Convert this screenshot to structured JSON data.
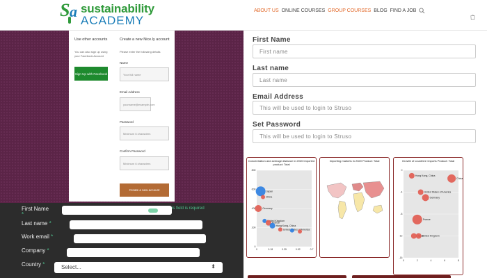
{
  "header": {
    "logo_line1": "sustainability",
    "logo_line2": "ACADEMY",
    "nav": [
      {
        "label": "ABOUT US",
        "active": true
      },
      {
        "label": "ONLINE COURSES",
        "active": false
      },
      {
        "label": "GROUP COURSES",
        "active": true
      },
      {
        "label": "BLOG",
        "active": false
      },
      {
        "label": "FIND A JOB",
        "active": false
      }
    ],
    "accent": "#e2692a"
  },
  "signup_card": {
    "left_title": "Use other accounts",
    "left_text": "You can also sign up using your Facebook Account",
    "fb_button": "Sign Up with Facebook",
    "right_title": "Create a new Nice.ly account",
    "right_text": "Please enter the following details",
    "fields": [
      {
        "label": "Name",
        "placeholder": "Your full name"
      },
      {
        "label": "Email Address",
        "placeholder": "yourname@example.com"
      },
      {
        "label": "Password",
        "placeholder": "Minimum 6 characters"
      },
      {
        "label": "Confirm Password",
        "placeholder": "Minimum 6 characters"
      }
    ],
    "create_button": "Create a new account"
  },
  "dark_form": {
    "first_name_label": "First Name",
    "last_name_label": "Last name",
    "work_email_label": "Work email",
    "company_label": "Company",
    "country_label": "Country",
    "hint": "is field is required",
    "select_value": "Select...",
    "required_mark": "*"
  },
  "right_form": {
    "first_name_label": "First Name",
    "first_name_placeholder": "First name",
    "last_name_label": "Last name",
    "last_name_placeholder": "Last name",
    "email_label": "Email Address",
    "email_placeholder": "This will be used to login to Struso",
    "password_label": "Set Password",
    "password_placeholder": "This will be used to login to Struso"
  },
  "chart_data": [
    {
      "type": "scatter",
      "title": "Concentration and average distance in 2020 Imported product: Total",
      "x": [
        0.02,
        0.05,
        0.08,
        0.1,
        0.15,
        0.2,
        0.3,
        0.45,
        0.55
      ],
      "y": [
        400,
        580,
        520,
        270,
        250,
        220,
        180,
        170,
        160
      ],
      "labels": [
        "Germany",
        "Japan",
        "China",
        "United Kingdom",
        "France",
        "Hong Kong, China",
        "United States of America",
        "",
        ""
      ],
      "ylim": [
        0,
        800
      ],
      "xlim": [
        0,
        0.7
      ]
    },
    {
      "type": "map",
      "title": "Importing markets in 2020 Product: Total"
    },
    {
      "type": "scatter",
      "title": "Growth of countries' imports Product: Total",
      "labels": [
        "Hong Kong, China",
        "China",
        "United States of America",
        "Germany",
        "France",
        "Japan",
        "United Kingdom"
      ],
      "x": [
        1.2,
        7,
        2.5,
        3.2,
        2,
        1.5,
        2.2
      ],
      "y": [
        -1,
        -1.5,
        -4,
        -5,
        -9,
        -12,
        -12
      ],
      "xlim": [
        0,
        8
      ],
      "ylim": [
        -16,
        0
      ]
    }
  ]
}
